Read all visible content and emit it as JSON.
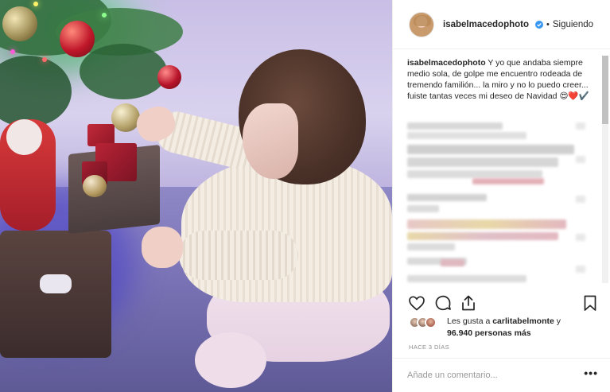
{
  "post": {
    "username": "isabelmacedophoto",
    "follow_status": "Siguiendo",
    "caption_user": "isabelmacedophoto",
    "caption_text": "Y yo que andaba siempre medio sola, de golpe me encuentro rodeada de tremendo familión... la miro y no lo puedo creer... fuiste tantas veces mi deseo de Navidad 😍❤️✔️"
  },
  "likes": {
    "prefix": "Les gusta a ",
    "user": "carlitabelmonte",
    "connector": " y",
    "count": "96.940 personas más"
  },
  "time_ago": "HACE 3 DÍAS",
  "comment_placeholder": "Añade un comentario...",
  "more_label": "•••",
  "icons": [
    "heart-icon",
    "comment-icon",
    "share-icon",
    "bookmark-icon",
    "verified-icon"
  ],
  "colors": {
    "verified": "#3897f0",
    "text": "#262626",
    "muted": "#8e8e8e",
    "border": "#efefef"
  }
}
